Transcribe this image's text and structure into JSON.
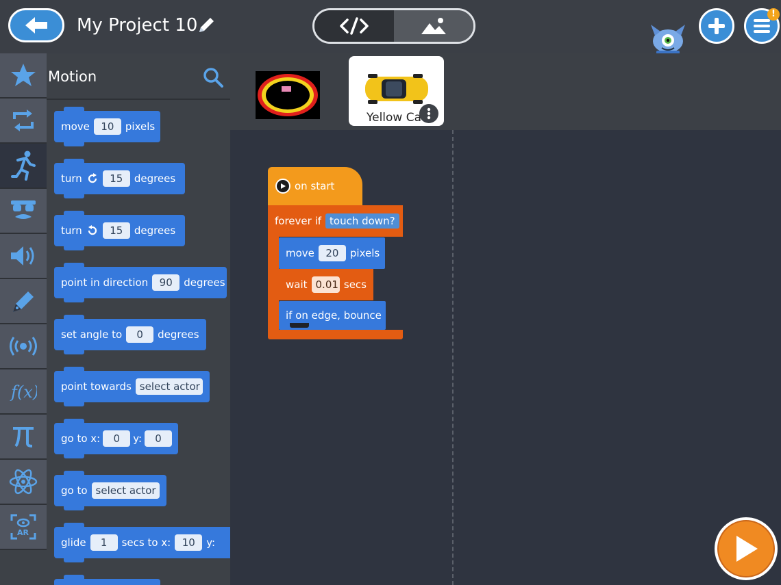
{
  "header": {
    "project_title": "My Project 10"
  },
  "palette": {
    "category_title": "Motion",
    "blocks": [
      {
        "parts": [
          "move",
          "10",
          "pixels"
        ]
      },
      {
        "parts": [
          "turn",
          "15",
          "degrees"
        ]
      },
      {
        "parts": [
          "turn",
          "15",
          "degrees"
        ]
      },
      {
        "parts": [
          "point in direction",
          "90",
          "degrees"
        ]
      },
      {
        "parts": [
          "set angle to",
          "0",
          "degrees"
        ]
      },
      {
        "parts": [
          "point towards",
          "select actor"
        ]
      },
      {
        "parts": [
          "go to x:",
          "0",
          "y:",
          "0"
        ]
      },
      {
        "parts": [
          "go to",
          "select actor"
        ]
      },
      {
        "parts": [
          "glide",
          "1",
          "secs to x:",
          "10",
          "y:"
        ]
      }
    ]
  },
  "actors": {
    "selected_name": "Yellow Ca"
  },
  "script": {
    "on_start": "on start",
    "forever_if": "forever if",
    "condition": "touch down?",
    "move": "move",
    "move_value": "20",
    "pixels": "pixels",
    "wait": "wait",
    "wait_value": "0.01",
    "secs": "secs",
    "edge_bounce": "if on edge, bounce"
  },
  "colors": {
    "accent_blue": "#3b8ed6",
    "motion_block": "#3679dc",
    "control_block": "#e35c12",
    "event_block": "#f39a1c",
    "run_button": "#f08a22"
  },
  "icons": {
    "categories": [
      "star-icon",
      "loop-icon",
      "runner-icon",
      "disguise-icon",
      "sound-icon",
      "pen-icon",
      "broadcast-icon",
      "function-icon",
      "pi-icon",
      "atom-icon",
      "ar-icon"
    ]
  }
}
